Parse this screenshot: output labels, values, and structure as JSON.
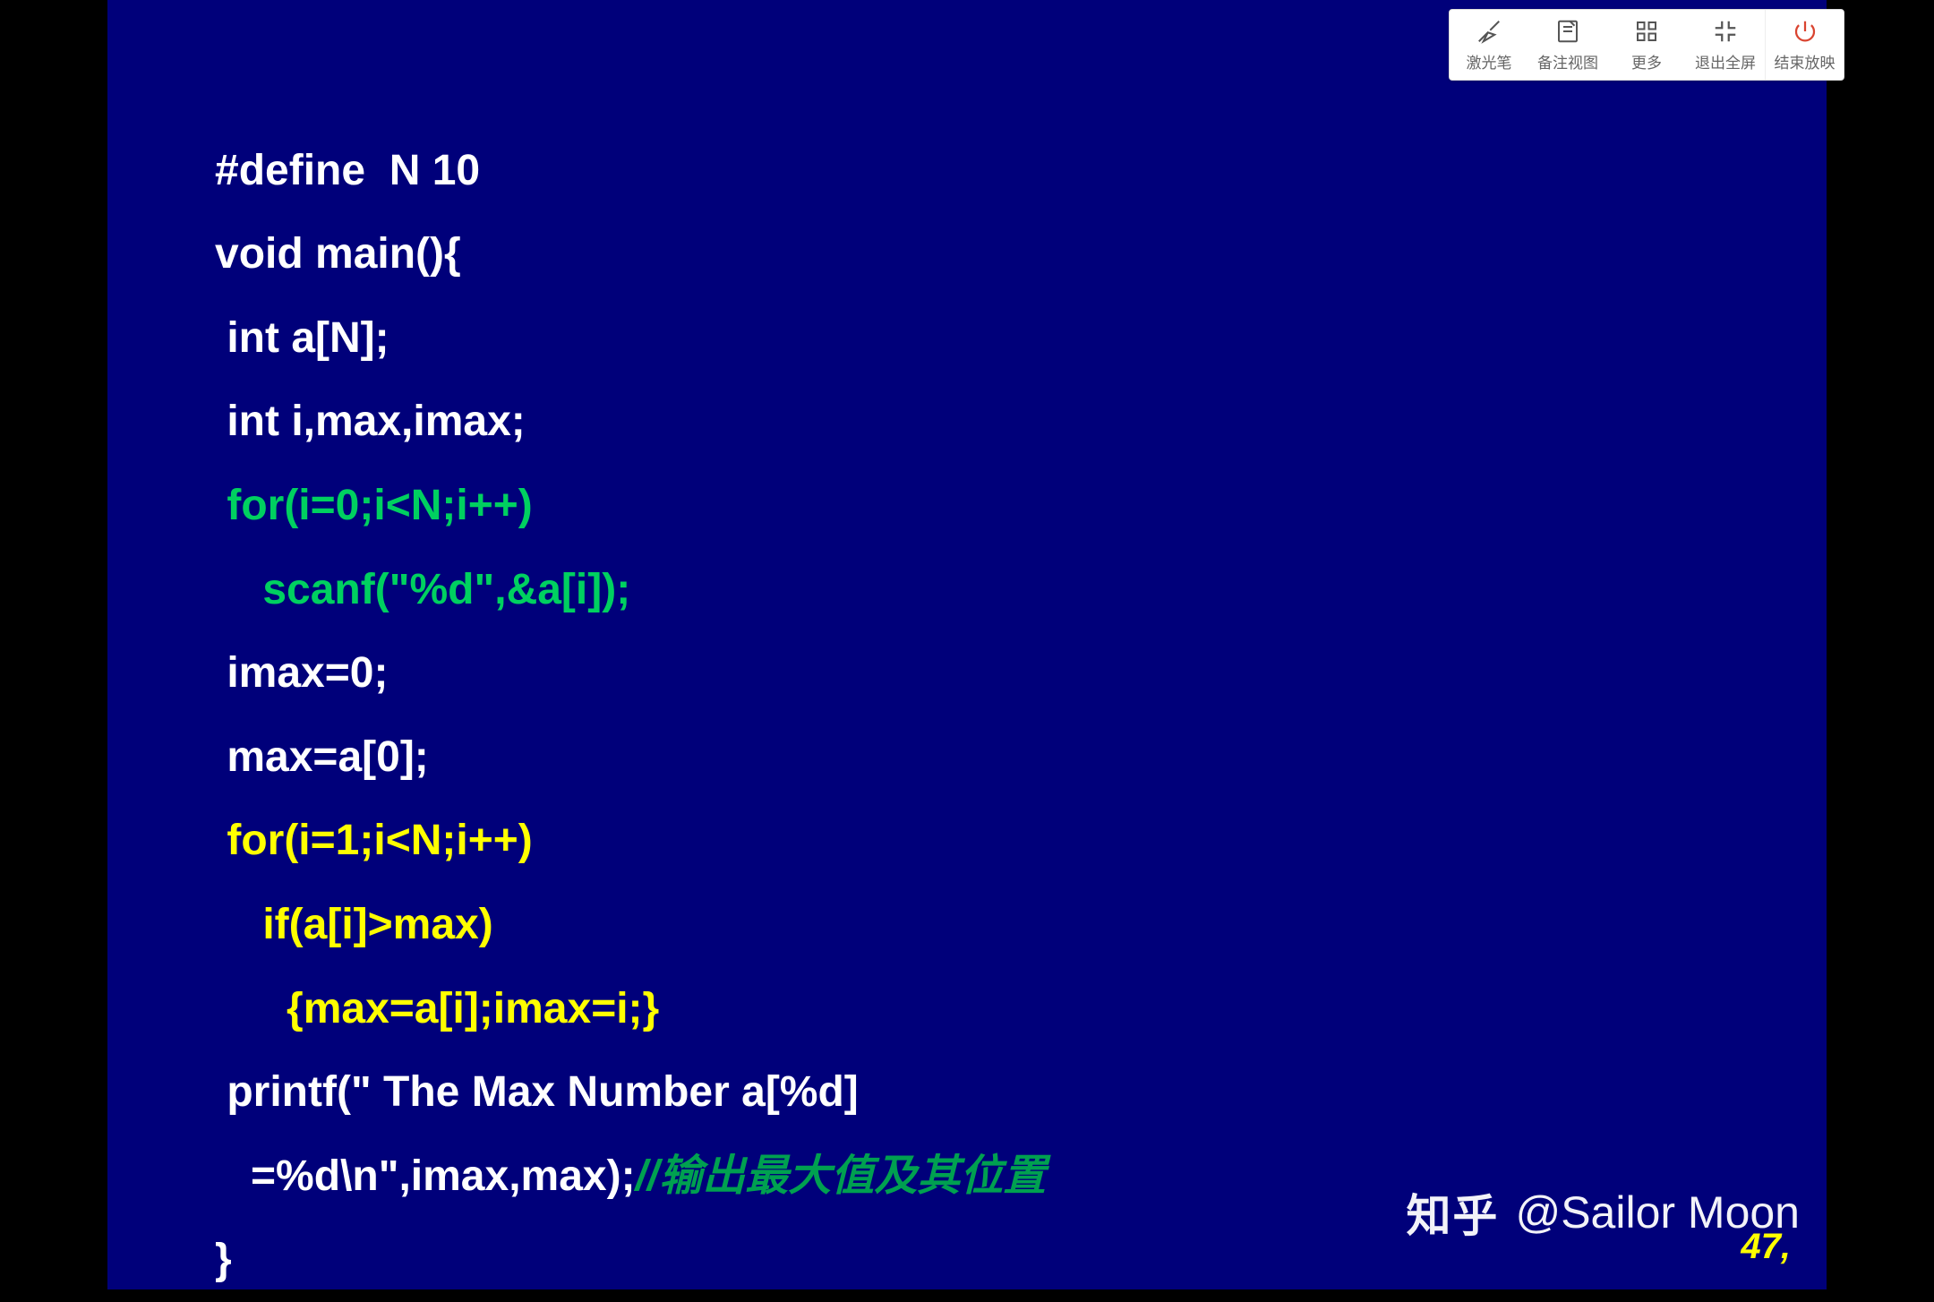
{
  "toolbar": {
    "items": [
      {
        "label": "激光笔"
      },
      {
        "label": "备注视图"
      },
      {
        "label": "更多"
      },
      {
        "label": "退出全屏"
      },
      {
        "label": "结束放映"
      }
    ]
  },
  "code": {
    "l1": "#define  N 10",
    "l2": "void main(){",
    "l3": " int a[N];",
    "l4": " int i,max,imax;",
    "l5": " for(i=0;i<N;i++)",
    "l6": "    scanf(\"%d\",&a[i]);",
    "l7": " imax=0;",
    "l8": " max=a[0];",
    "l9": " for(i=1;i<N;i++)",
    "l10": "    if(a[i]>max)",
    "l11": "      {max=a[i];imax=i;}",
    "l12": " printf(\" The Max Number a[%d]",
    "l13a": "   =%d\\n\",imax,max);",
    "l13b": "//输出最大值及其位置",
    "l14": "}"
  },
  "slide_number": "47,",
  "watermark": {
    "site": "知乎",
    "author": "@Sailor Moon"
  }
}
